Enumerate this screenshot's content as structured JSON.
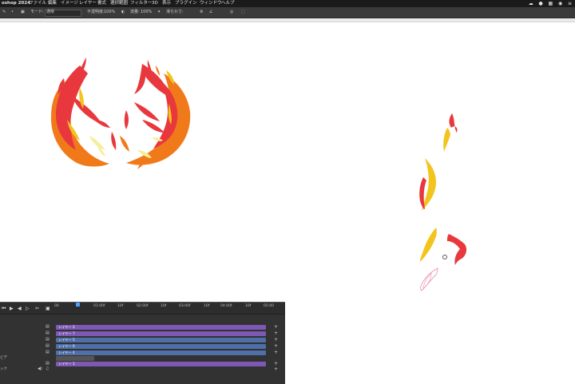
{
  "menubar": {
    "app_name": "oshop 2024",
    "items": [
      "ファイル",
      "編集",
      "イメージ",
      "レイヤー",
      "書式",
      "選択範囲",
      "フィルター",
      "3D",
      "表示",
      "プラグイン",
      "ウィンドウ",
      "ヘルプ"
    ]
  },
  "options_bar": {
    "mode_label": "モード:",
    "mode_value": "通常",
    "opacity_label": "不透明度:",
    "opacity_value": "100%",
    "flow_label": "流量:",
    "flow_value": "100%",
    "smoothing_label": "滑らかさ:"
  },
  "timeline": {
    "ruler_labels": [
      "00",
      "01:00f",
      "10f",
      "02:00f",
      "10f",
      "03:00f",
      "10f",
      "04:00f",
      "10f",
      "05:00"
    ],
    "tracks": [
      {
        "label": "レイヤー 2",
        "style": "purple"
      },
      {
        "label": "レイヤー 7",
        "style": "purple"
      },
      {
        "label": "レイヤー 5",
        "style": "blue"
      },
      {
        "label": "レイヤー 6",
        "style": "blue"
      },
      {
        "label": "レイヤー 4",
        "style": "blue"
      },
      {
        "label": "",
        "style": "gray"
      },
      {
        "label": "レイヤー 1",
        "style": "purple"
      }
    ],
    "side_labels": [
      "ビデ",
      "ック"
    ]
  },
  "colors": {
    "flame_red": "#e8383d",
    "flame_orange": "#f07a1a",
    "flame_yellow": "#f2c41c",
    "flame_pale": "#f5ee9a",
    "onion_skin": "#f0a0b8"
  },
  "icons": [
    "apple-logo-icon",
    "brush-tool-icon",
    "brush-preset-icon",
    "airbrush-icon",
    "settings-icon",
    "play-icon",
    "first-frame-icon",
    "prev-frame-icon",
    "next-frame-icon",
    "audio-icon",
    "scissors-icon",
    "add-track-icon"
  ]
}
